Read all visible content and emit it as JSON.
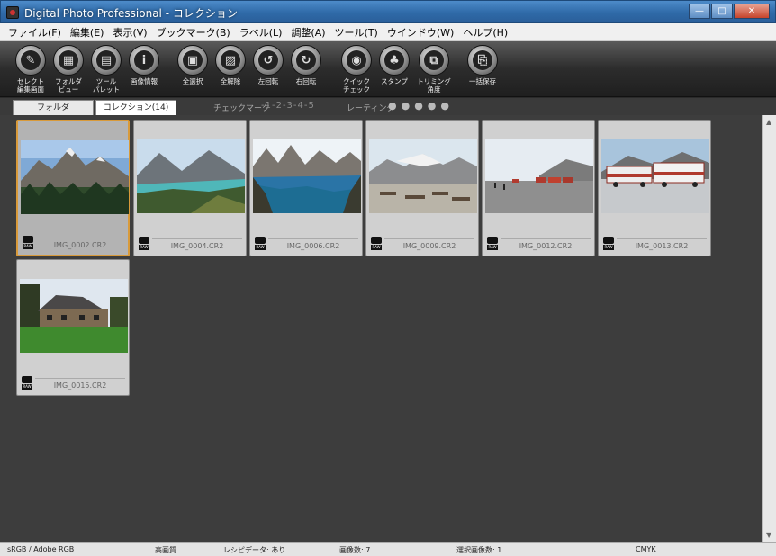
{
  "window": {
    "title": "Digital Photo Professional - コレクション",
    "buttons": {
      "minimize": "—",
      "maximize": "□",
      "close": "✕"
    }
  },
  "menu": [
    "ファイル(F)",
    "編集(E)",
    "表示(V)",
    "ブックマーク(B)",
    "ラベル(L)",
    "調整(A)",
    "ツール(T)",
    "ウインドウ(W)",
    "ヘルプ(H)"
  ],
  "toolbar": [
    {
      "label": "セレクト\n編集画面",
      "icon": "select-edit-icon",
      "glyph": "✎"
    },
    {
      "label": "フォルダ\nビュー",
      "icon": "folder-view-icon",
      "glyph": "▦"
    },
    {
      "label": "ツール\nパレット",
      "icon": "tool-palette-icon",
      "glyph": "▤"
    },
    {
      "label": "画像情報",
      "icon": "info-icon",
      "glyph": "i"
    },
    {
      "label": "全選択",
      "icon": "select-all-icon",
      "glyph": "▣"
    },
    {
      "label": "全解除",
      "icon": "deselect-all-icon",
      "glyph": "▨"
    },
    {
      "label": "左回転",
      "icon": "rotate-left-icon",
      "glyph": "↺"
    },
    {
      "label": "右回転",
      "icon": "rotate-right-icon",
      "glyph": "↻"
    },
    {
      "label": "クイック\nチェック",
      "icon": "quick-check-icon",
      "glyph": "◉"
    },
    {
      "label": "スタンプ",
      "icon": "stamp-icon",
      "glyph": "♣"
    },
    {
      "label": "トリミング\n角度",
      "icon": "trimming-icon",
      "glyph": "⧉"
    },
    {
      "label": "一括保存",
      "icon": "batch-save-icon",
      "glyph": "⎘"
    }
  ],
  "tabs": {
    "folder": "フォルダ",
    "collection": "コレクション(14)"
  },
  "filters": {
    "checkmark_label": "チェックマーク",
    "checkmark_values": "-1-2-3-4-5",
    "rating_label": "レーティング",
    "rating_dots": "●●●●●"
  },
  "thumbnails": [
    {
      "filename": "IMG_0002.CR2",
      "selected": true,
      "tag": "RAW",
      "scene": "mountain-forest"
    },
    {
      "filename": "IMG_0004.CR2",
      "selected": false,
      "tag": "RAW",
      "scene": "glacier-lake"
    },
    {
      "filename": "IMG_0006.CR2",
      "selected": false,
      "tag": "RAW",
      "scene": "lake-peaks"
    },
    {
      "filename": "IMG_0009.CR2",
      "selected": false,
      "tag": "RAW",
      "scene": "picnic-glacier"
    },
    {
      "filename": "IMG_0012.CR2",
      "selected": false,
      "tag": "RAW",
      "scene": "snowcoach-parking"
    },
    {
      "filename": "IMG_0013.CR2",
      "selected": false,
      "tag": "RAW",
      "scene": "snowcoach-ice"
    },
    {
      "filename": "IMG_0015.CR2",
      "selected": false,
      "tag": "RAW",
      "scene": "lodge-lawn"
    }
  ],
  "status": {
    "colorspace": "sRGB / Adobe RGB",
    "quality": "高画質",
    "recipe": "レシピデータ: あり",
    "count": "画像数: 7",
    "selected": "選択画像数: 1",
    "cmyk": "CMYK"
  }
}
